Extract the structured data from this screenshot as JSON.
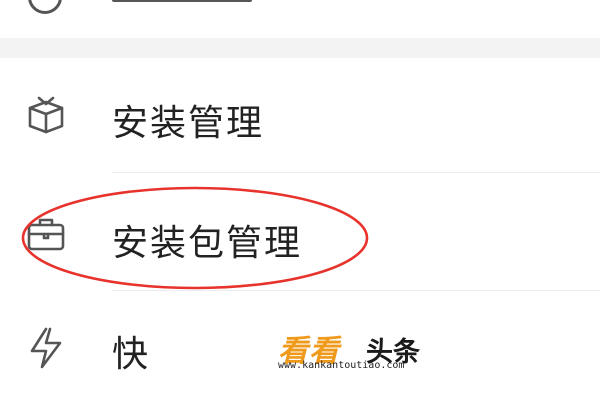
{
  "menu": {
    "items": [
      {
        "label": "安装管理",
        "icon": "box-icon"
      },
      {
        "label": "安装包管理",
        "icon": "briefcase-icon"
      },
      {
        "label": "快",
        "icon": "lightning-icon"
      }
    ]
  },
  "annotation": {
    "oval_color": "#e8332d"
  },
  "watermark": {
    "brand_orange": "看看",
    "brand_dark": "头条",
    "url": "www.kankantoutiao.com"
  },
  "colors": {
    "background": "#f6f6f7",
    "card": "#ffffff",
    "text": "#222222",
    "icon": "#555555",
    "watermark_orange": "#f09a1c"
  }
}
